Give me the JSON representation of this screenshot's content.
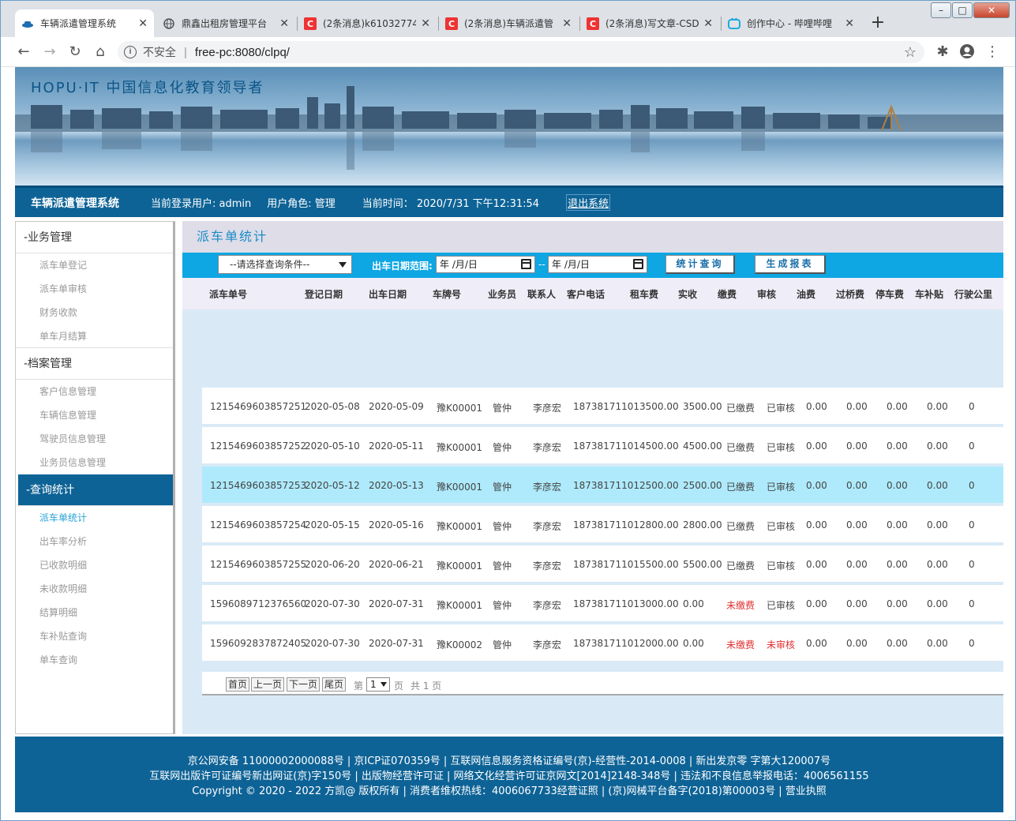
{
  "browser": {
    "tabs": [
      {
        "title": "车辆派遣管理系统",
        "icon": "car-favicon"
      },
      {
        "title": "鼎鑫出租房管理平台",
        "icon": "globe-icon"
      },
      {
        "title": "(2条消息)k61032774",
        "icon": "csdn-icon"
      },
      {
        "title": "(2条消息)车辆派遣管",
        "icon": "csdn-icon"
      },
      {
        "title": "(2条消息)写文章-CSD",
        "icon": "csdn-icon"
      },
      {
        "title": "创作中心 - 哔哩哔哩",
        "icon": "bilibili-icon"
      }
    ],
    "security_label": "不安全",
    "url": "free-pc:8080/clpq/"
  },
  "banner": {
    "brand": "HOPU·IT 中国信息化教育领导者"
  },
  "header": {
    "system_name": "车辆派遣管理系统",
    "current_user": "当前登录用户: admin",
    "role": "用户角色: 管理",
    "time": "当前时间： 2020/7/31 下午12:31:54",
    "logout": "退出系统"
  },
  "sidebar": {
    "groups": [
      {
        "title": "-业务管理",
        "items": [
          "派车单登记",
          "派车单审核",
          "财务收款",
          "单车月结算"
        ]
      },
      {
        "title": "-档案管理",
        "items": [
          "客户信息管理",
          "车辆信息管理",
          "驾驶员信息管理",
          "业务员信息管理"
        ]
      },
      {
        "title": "-查询统计",
        "items": [
          "派车单统计",
          "出车率分析",
          "已收款明细",
          "未收款明细",
          "结算明细",
          "车补贴查询",
          "单车查询"
        ]
      }
    ]
  },
  "main": {
    "title": "派车单统计",
    "query": {
      "condition_placeholder": "--请选择查询条件--",
      "date_range_label": "出车日期范围:",
      "date_from": "年 /月/日",
      "date_sep": "--",
      "date_to": "年 /月/日",
      "search_btn": "统计查询",
      "report_btn": "生成报表"
    },
    "columns": [
      "派车单号",
      "登记日期",
      "出车日期",
      "车牌号",
      "业务员",
      "联系人",
      "客户电话",
      "租车费",
      "实收",
      "缴费",
      "审核",
      "油费",
      "过桥费",
      "停车费",
      "车补贴",
      "行驶公里"
    ],
    "rows": [
      [
        "1215469603857251",
        "2020-05-08",
        "2020-05-09",
        "豫K00001",
        "管仲",
        "李彦宏",
        "18738171101",
        "3500.00",
        "3500.00",
        "已缴费",
        "已审核",
        "0.00",
        "0.00",
        "0.00",
        "0.00",
        "0"
      ],
      [
        "1215469603857252",
        "2020-05-10",
        "2020-05-11",
        "豫K00001",
        "管仲",
        "李彦宏",
        "18738171101",
        "4500.00",
        "4500.00",
        "已缴费",
        "已审核",
        "0.00",
        "0.00",
        "0.00",
        "0.00",
        "0"
      ],
      [
        "1215469603857253",
        "2020-05-12",
        "2020-05-13",
        "豫K00001",
        "管仲",
        "李彦宏",
        "18738171101",
        "2500.00",
        "2500.00",
        "已缴费",
        "已审核",
        "0.00",
        "0.00",
        "0.00",
        "0.00",
        "0"
      ],
      [
        "1215469603857254",
        "2020-05-15",
        "2020-05-16",
        "豫K00001",
        "管仲",
        "李彦宏",
        "18738171101",
        "2800.00",
        "2800.00",
        "已缴费",
        "已审核",
        "0.00",
        "0.00",
        "0.00",
        "0.00",
        "0"
      ],
      [
        "1215469603857255",
        "2020-06-20",
        "2020-06-21",
        "豫K00001",
        "管仲",
        "李彦宏",
        "18738171101",
        "5500.00",
        "5500.00",
        "已缴费",
        "已审核",
        "0.00",
        "0.00",
        "0.00",
        "0.00",
        "0"
      ],
      [
        "1596089712376560",
        "2020-07-30",
        "2020-07-31",
        "豫K00001",
        "管仲",
        "李彦宏",
        "18738171101",
        "3000.00",
        "0.00",
        "未缴费",
        "已审核",
        "0.00",
        "0.00",
        "0.00",
        "0.00",
        "0"
      ],
      [
        "1596092837872405",
        "2020-07-30",
        "2020-07-31",
        "豫K00002",
        "管仲",
        "李彦宏",
        "18738171101",
        "2000.00",
        "0.00",
        "未缴费",
        "未审核",
        "0.00",
        "0.00",
        "0.00",
        "0.00",
        "0"
      ]
    ],
    "pager": {
      "first": "首页",
      "prev": "上一页",
      "next": "下一页",
      "last": "尾页",
      "page_prefix": "第",
      "page_value": "1",
      "page_suffix": "页",
      "total": "共 1 页"
    }
  },
  "footer": {
    "line1": "京公网安备 11000002000088号 | 京ICP证070359号 | 互联网信息服务资格证编号(京)-经营性-2014-0008 | 新出发京零 字第大120007号",
    "line2": "互联网出版许可证编号新出网证(京)字150号 | 出版物经营许可证 | 网络文化经营许可证京网文[2014]2148-348号 | 违法和不良信息举报电话：4006561155",
    "line3": "Copyright © 2020 - 2022 方凯@ 版权所有 | 消费者维权热线：4006067733经营证照 | (京)网械平台备字(2018)第00003号 | 营业执照"
  },
  "colors": {
    "header_blue": "#0e6396",
    "query_bar": "#0ea6e3",
    "highlight_row": "#aeeafc",
    "unpaid_red": "#e03030"
  }
}
